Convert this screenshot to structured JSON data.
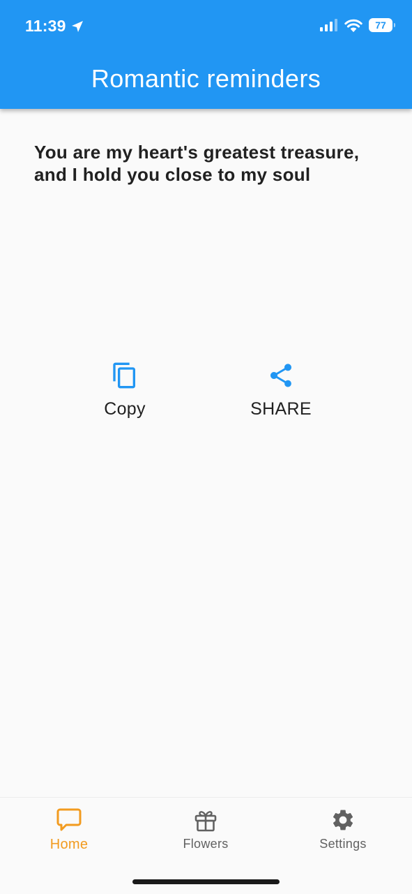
{
  "status_bar": {
    "time": "11:39",
    "battery_level": "77"
  },
  "app_bar": {
    "title": "Romantic reminders"
  },
  "main": {
    "quote": "You are my heart's greatest treasure, and I hold you close to my soul",
    "copy_label": "Copy",
    "share_label": "SHARE"
  },
  "bottom_nav": {
    "items": [
      {
        "label": "Home",
        "icon": "chat-bubble-icon",
        "active": true
      },
      {
        "label": "Flowers",
        "icon": "gift-icon",
        "active": false
      },
      {
        "label": "Settings",
        "icon": "gear-icon",
        "active": false
      }
    ]
  },
  "colors": {
    "primary": "#2196f3",
    "active_tab": "#f29b1f",
    "inactive_tab": "#616161",
    "text": "#212121",
    "background": "#fafafa"
  }
}
